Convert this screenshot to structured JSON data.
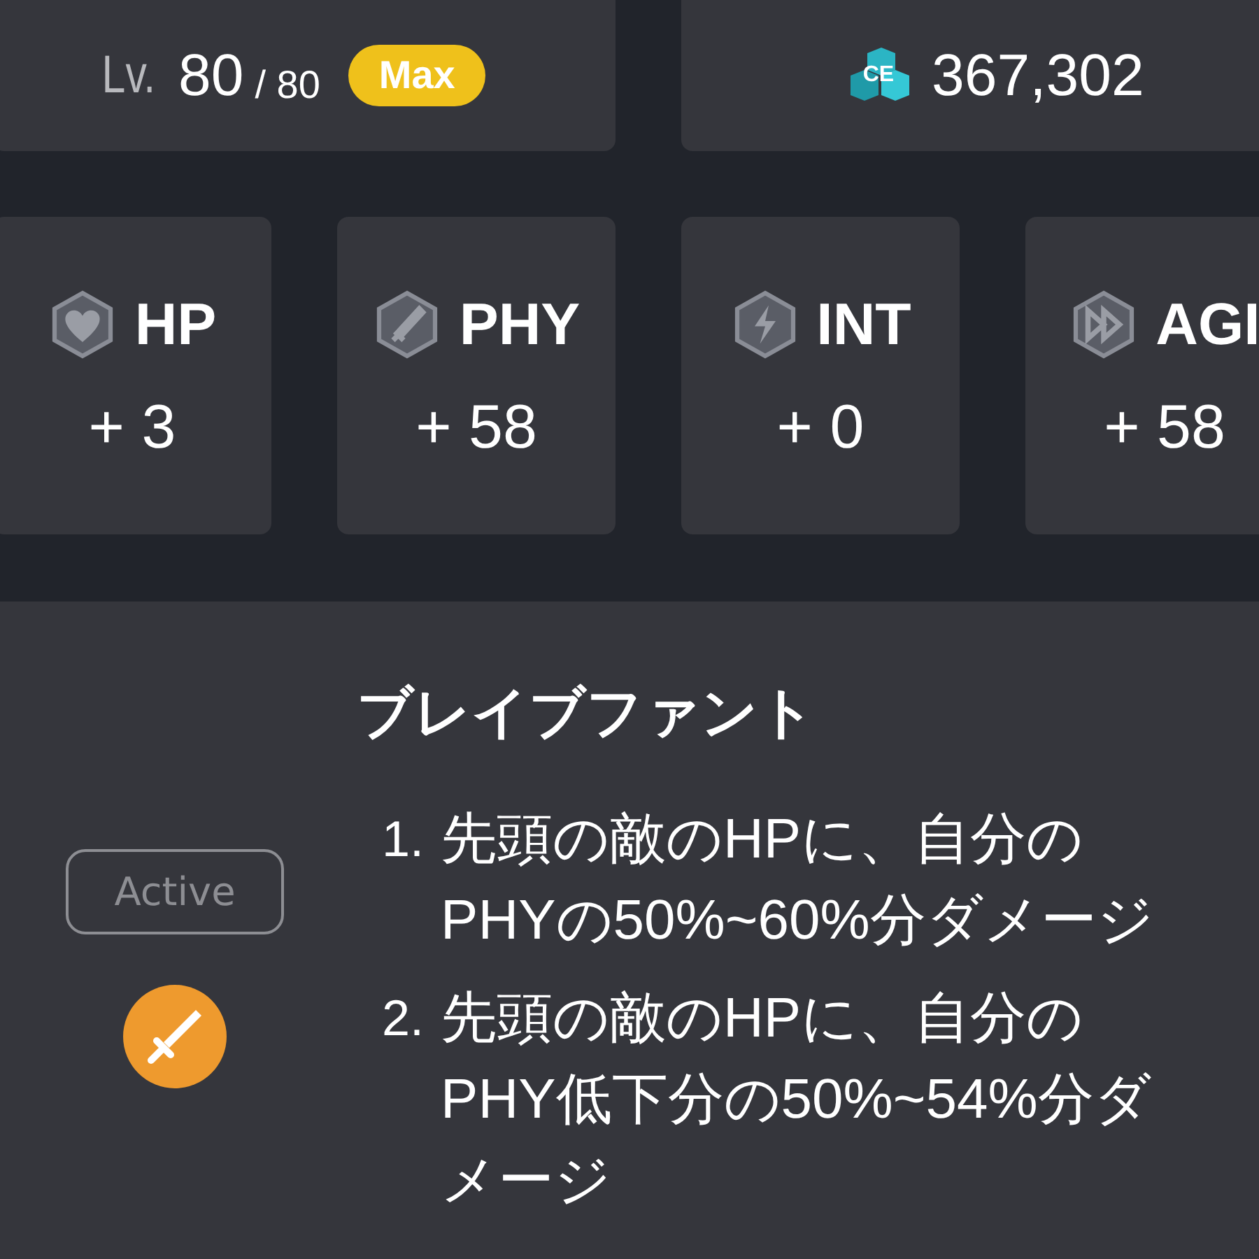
{
  "level": {
    "label": "Lv.",
    "current": "80",
    "separator": "/",
    "max": "80",
    "badge": "Max"
  },
  "ce": {
    "icon_text": "CE",
    "value": "367,302"
  },
  "stats": [
    {
      "kind": "hp",
      "label": "HP",
      "value": "+ 3"
    },
    {
      "kind": "phy",
      "label": "PHY",
      "value": "+ 58"
    },
    {
      "kind": "int",
      "label": "INT",
      "value": "+ 0"
    },
    {
      "kind": "agi",
      "label": "AGI",
      "value": "+ 58"
    }
  ],
  "skill": {
    "type": "Active",
    "name": "ブレイブファント",
    "effects": [
      {
        "number": "1.",
        "text": "先頭の敵のHPに、自分のPHYの50%~60%分ダメージ"
      },
      {
        "number": "2.",
        "text": "先頭の敵のHPに、自分のPHY低下分の50%~54%分ダメージ"
      }
    ]
  }
}
